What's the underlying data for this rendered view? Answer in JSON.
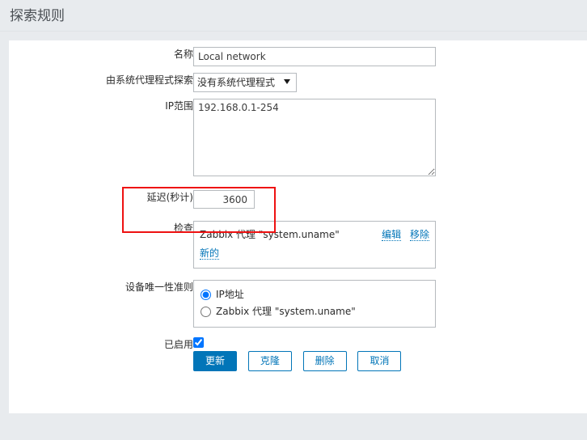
{
  "page": {
    "title": "探索规则",
    "accent_color": "#0275b8",
    "highlight_color": "#ee1111",
    "background_color": "#e8ebee"
  },
  "form": {
    "name": {
      "label": "名称",
      "value": "Local network",
      "placeholder": ""
    },
    "proxy": {
      "label": "由系统代理程式探索",
      "selected": "没有系统代理程式",
      "options": [
        "没有系统代理程式"
      ],
      "arrow_icon": "chevron-down-icon"
    },
    "ip_range": {
      "label": "IP范围",
      "value": "192.168.0.1-254",
      "resize_handle_icon": "resize-handle-icon"
    },
    "delay": {
      "label": "延迟(秒计)",
      "value": "3600",
      "highlighted": true
    },
    "checks": {
      "label": "检查",
      "items": [
        {
          "name": "Zabbix 代理 \"system.uname\"",
          "edit_label": "编辑",
          "remove_label": "移除"
        }
      ],
      "new_label": "新的"
    },
    "uniqueness": {
      "label": "设备唯一性准则",
      "options": [
        {
          "label": "IP地址",
          "selected": true
        },
        {
          "label": "Zabbix 代理 \"system.uname\"",
          "selected": false
        }
      ]
    },
    "enabled": {
      "label": "已启用",
      "checked": true
    }
  },
  "buttons": {
    "update": "更新",
    "clone": "克隆",
    "delete": "删除",
    "cancel": "取消"
  }
}
